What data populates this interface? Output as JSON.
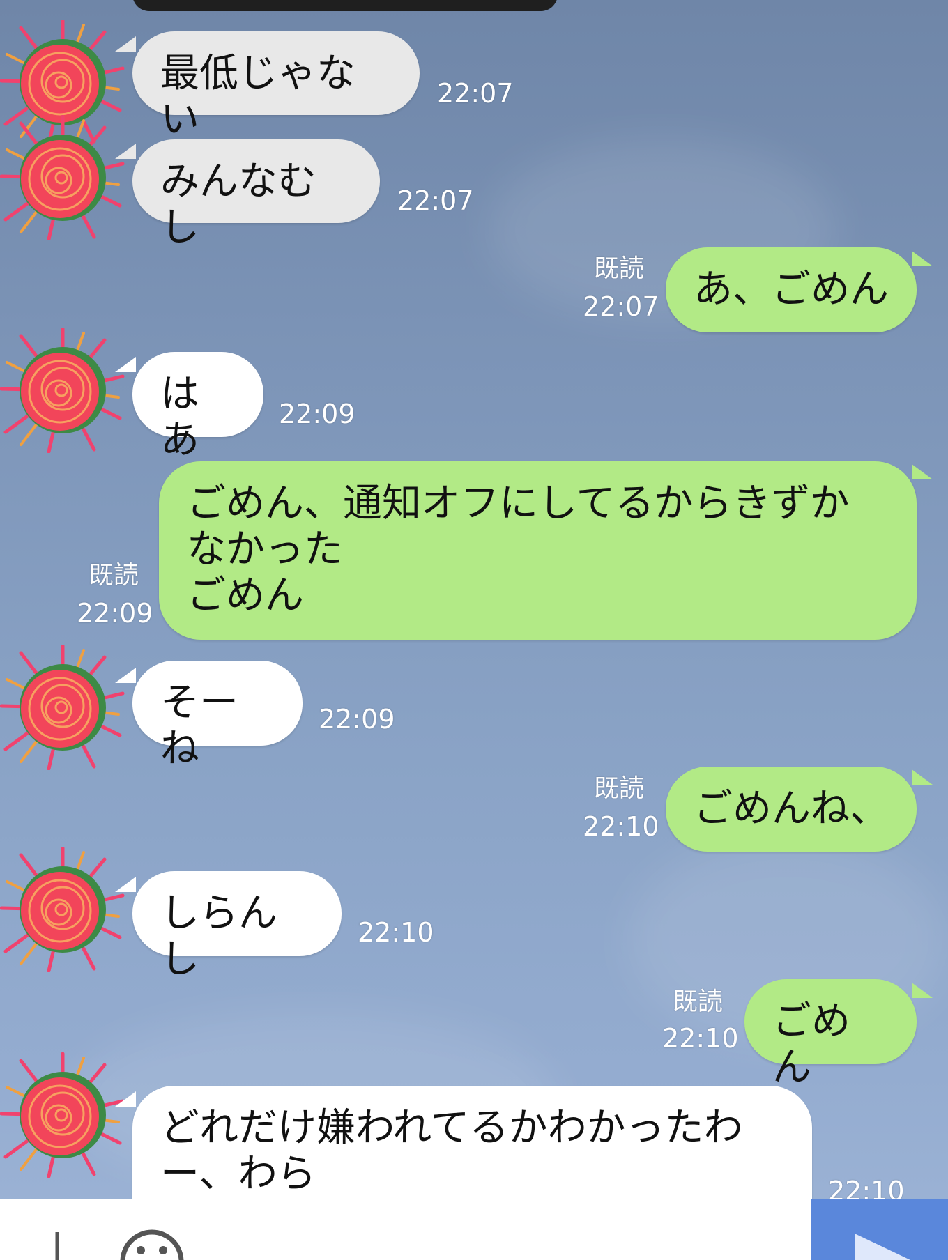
{
  "messages": [
    {
      "side": "in",
      "style": "gray",
      "text": "最低じゃない",
      "time": "22:07"
    },
    {
      "side": "in",
      "style": "gray",
      "text": "みんなむし",
      "time": "22:07"
    },
    {
      "side": "out",
      "text": "あ、ごめん",
      "read": "既読",
      "time": "22:07"
    },
    {
      "side": "in",
      "style": "white",
      "text": "はあ",
      "time": "22:09"
    },
    {
      "side": "out",
      "text": "ごめん、通知オフにしてるからきずか\nなかった\nごめん",
      "read": "既読",
      "time": "22:09"
    },
    {
      "side": "in",
      "style": "white",
      "text": "そーね",
      "time": "22:09"
    },
    {
      "side": "out",
      "text": "ごめんね、",
      "read": "既読",
      "time": "22:10"
    },
    {
      "side": "in",
      "style": "white",
      "text": "しらんし",
      "time": "22:10"
    },
    {
      "side": "out",
      "text": "ごめん",
      "read": "既読",
      "time": "22:10"
    },
    {
      "side": "in",
      "style": "white",
      "text": "どれだけ嫌われてるかわかったわ\nー、わら",
      "time": "22:10"
    }
  ],
  "input_bar": {
    "plus_icon": "plus-icon",
    "emoji_icon": "smiley-icon",
    "send_icon": "send-arrow-icon"
  },
  "colors": {
    "out_bubble": "#b2ea86",
    "in_bubble": "#ffffff",
    "in_bubble_gray": "#e8e8e8",
    "send_button": "#5a87db"
  }
}
